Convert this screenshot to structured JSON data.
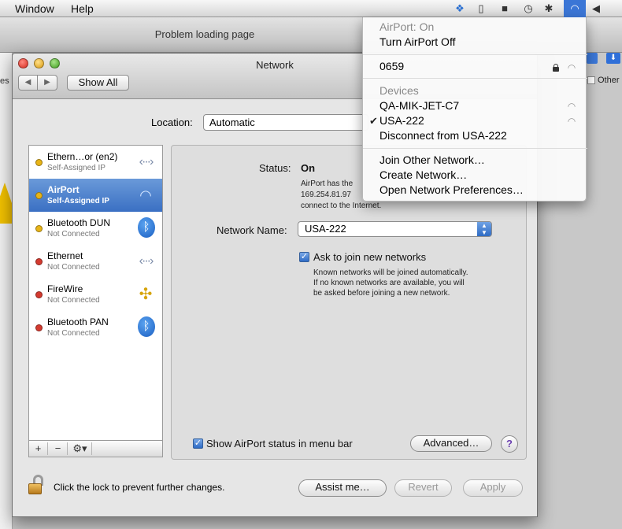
{
  "menubar": {
    "items": [
      "Window",
      "Help"
    ],
    "tray_icons": [
      "dropbox-icon",
      "clipboard-icon",
      "truck-icon",
      "time-machine-icon",
      "airport-icon",
      "volume-icon"
    ]
  },
  "background_window": {
    "title": "Problem loading page",
    "bookmark_label": "Other",
    "partial_text": "es"
  },
  "network_window": {
    "title": "Network",
    "show_all_label": "Show All",
    "location_label": "Location:",
    "location_value": "Automatic",
    "services": [
      {
        "name": "Ethern…or (en2)",
        "status": "Self-Assigned IP",
        "status_color": "#e8b417",
        "icon": "ethernet-icon",
        "selected": false
      },
      {
        "name": "AirPort",
        "status": "Self-Assigned IP",
        "status_color": "#e8b417",
        "icon": "wifi-icon",
        "selected": true
      },
      {
        "name": "Bluetooth DUN",
        "status": "Not Connected",
        "status_color": "#e8b417",
        "icon": "bluetooth-icon",
        "selected": false
      },
      {
        "name": "Ethernet",
        "status": "Not Connected",
        "status_color": "#d43a2f",
        "icon": "ethernet-icon",
        "selected": false
      },
      {
        "name": "FireWire",
        "status": "Not Connected",
        "status_color": "#d43a2f",
        "icon": "firewire-icon",
        "selected": false
      },
      {
        "name": "Bluetooth PAN",
        "status": "Not Connected",
        "status_color": "#d43a2f",
        "icon": "bluetooth-icon",
        "selected": false
      }
    ],
    "list_buttons": [
      "+",
      "−",
      "⚙▾"
    ],
    "status_label": "Status:",
    "status_value": "On",
    "status_desc_line1": "AirPort has the",
    "status_desc_line2": "169.254.81.97",
    "status_desc_line3": "connect to the Internet.",
    "network_name_label": "Network Name:",
    "network_name_value": "USA-222",
    "ask_join_label": "Ask to join new networks",
    "ask_join_desc": [
      "Known networks will be joined automatically.",
      "If no known networks are available, you will",
      "be asked before joining a new network."
    ],
    "show_status_label": "Show AirPort status in menu bar",
    "advanced_label": "Advanced…",
    "help_label": "?",
    "lock_text": "Click the lock to prevent further changes.",
    "assist_label": "Assist me…",
    "revert_label": "Revert",
    "apply_label": "Apply"
  },
  "airport_menu": {
    "status": "AirPort: On",
    "toggle": "Turn AirPort Off",
    "secure_network": "0659",
    "devices_header": "Devices",
    "devices": [
      "QA-MIK-JET-C7",
      "USA-222"
    ],
    "disconnect": "Disconnect from USA-222",
    "join_other": "Join Other Network…",
    "create": "Create Network…",
    "open_prefs": "Open Network Preferences…"
  },
  "colors": {
    "selection": "#3a70c3",
    "menubar_airport_highlight": "#3b76d6"
  }
}
